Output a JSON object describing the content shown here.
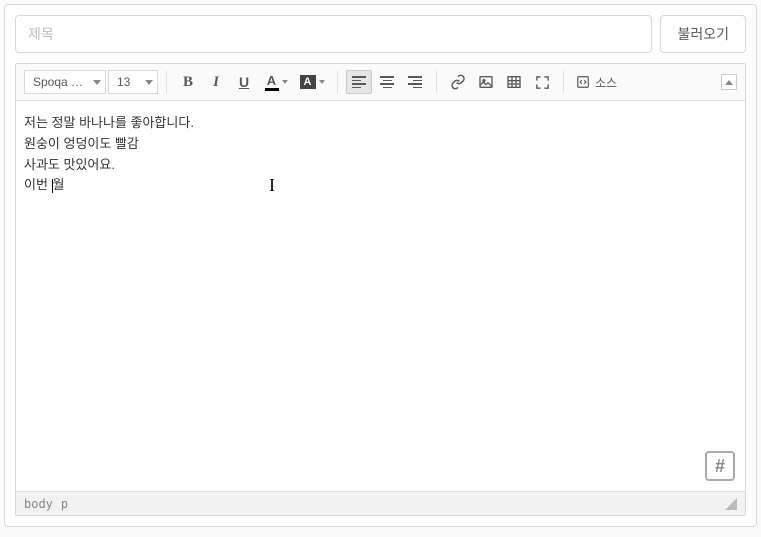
{
  "title_placeholder": "제목",
  "load_button": "불러오기",
  "toolbar": {
    "font_name": "Spoqa H...",
    "font_size": "13",
    "source_label": "소스"
  },
  "content": {
    "lines": [
      "저는 정말 바나나를 좋아합니다.",
      "원숭이 엉덩이도 빨감",
      "사과도 맛있어요.",
      "이번 월"
    ],
    "last_line_pre": "이번 ",
    "last_line_post": "월"
  },
  "statusbar": {
    "path1": "body",
    "path2": "p"
  },
  "hashtag": "#"
}
